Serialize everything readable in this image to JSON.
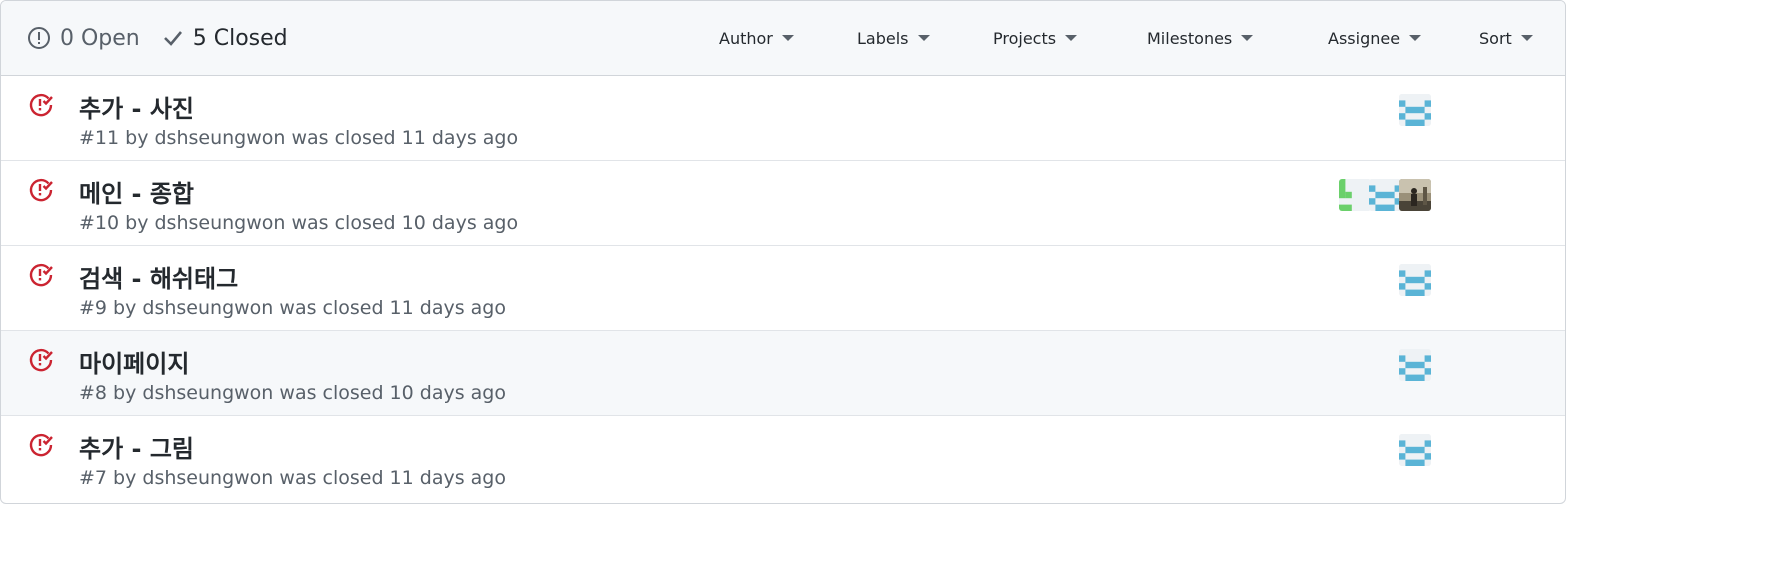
{
  "header": {
    "open_count_label": "0 Open",
    "closed_count_label": "5 Closed",
    "filters": {
      "author": "Author",
      "labels": "Labels",
      "projects": "Projects",
      "milestones": "Milestones",
      "assignee": "Assignee",
      "sort": "Sort"
    }
  },
  "issues": [
    {
      "title": "추가 - 사진",
      "number": "#11",
      "by": " by ",
      "author": "dshseungwon",
      "status": " was closed 11 days ago",
      "assignees": [
        "identicon-blue"
      ]
    },
    {
      "title": "메인 - 종합",
      "number": "#10",
      "by": " by ",
      "author": "dshseungwon",
      "status": " was closed 10 days ago",
      "assignees": [
        "identicon-green",
        "identicon-blue",
        "photo-avatar"
      ]
    },
    {
      "title": "검색 - 해쉬태그",
      "number": "#9",
      "by": " by ",
      "author": "dshseungwon",
      "status": " was closed 11 days ago",
      "assignees": [
        "identicon-blue"
      ]
    },
    {
      "title": "마이페이지",
      "number": "#8",
      "by": " by ",
      "author": "dshseungwon",
      "status": " was closed 10 days ago",
      "assignees": [
        "identicon-blue"
      ]
    },
    {
      "title": "추가 - 그림",
      "number": "#7",
      "by": " by ",
      "author": "dshseungwon",
      "status": " was closed 11 days ago",
      "assignees": [
        "identicon-blue"
      ]
    }
  ],
  "colors": {
    "closed_icon": "#cb2431",
    "identicon_blue": "#5ab4d6",
    "identicon_green": "#6bd06b"
  }
}
